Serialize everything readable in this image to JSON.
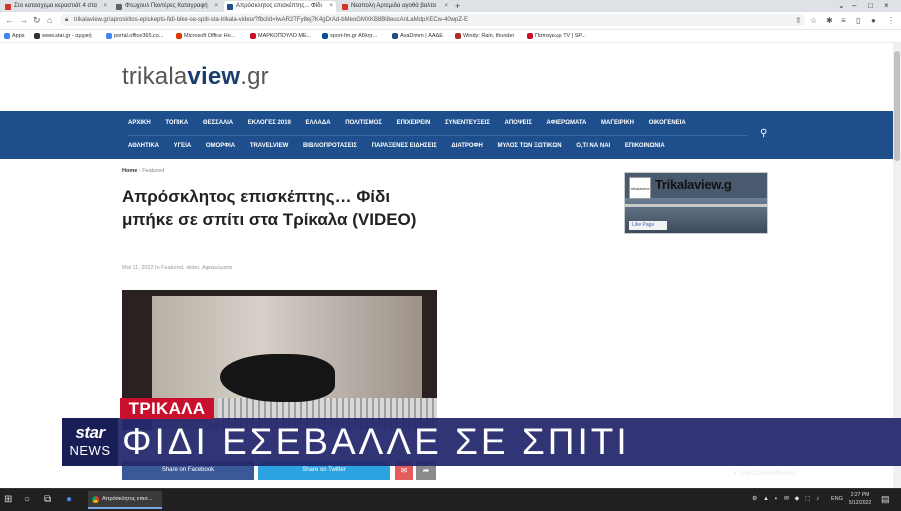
{
  "browser": {
    "tabs": [
      {
        "label": "Στο κατασχεμα κεραστιάτ 4 στα",
        "color": "#d93025"
      },
      {
        "label": "Φτωχουλ Παντέρες Καταγραφή",
        "color": "#5f6368"
      },
      {
        "label": "Απρόσκλητος επισκέπτης... Φίδι",
        "color": "#1e4f8c"
      },
      {
        "label": "Νεαπολη Αρτεμιδα αγοθά βαλτα",
        "color": "#d93025"
      }
    ],
    "new_tab": "+",
    "url": "trikalaview.gr/aproskltos-episkepts-fidi-bike-se-spiti-sta-trikala-video/?fbclid=IwAR2TFy8ej7K4gDrAd-bMeoGMXKB8Bl8eucAnLaMdpXECw-40wpZ-E",
    "lock_icon": "lock-icon",
    "bookmarks": [
      {
        "label": "Apps",
        "color": "#4285f4"
      },
      {
        "label": "www.star.gr - αρχική",
        "color": "#333333"
      },
      {
        "label": "portal.office365.co...",
        "color": "#4285f4"
      },
      {
        "label": "Microsoft Office Ho...",
        "color": "#d83b01"
      },
      {
        "label": "ΜΑΡΚΟΠΟΥΛΟ ΜΕ...",
        "color": "#c8102e"
      },
      {
        "label": "sport-fm.gr Αθλητ...",
        "color": "#0a4d9e"
      },
      {
        "label": "AvaDimm | ΑΑΔΕ",
        "color": "#1e4f8c"
      },
      {
        "label": "Windy: Rain, thunder",
        "color": "#b02a2a"
      },
      {
        "label": "Παπαγεωρ TV | SP...",
        "color": "#c8102e"
      }
    ]
  },
  "site": {
    "logo_prefix": "trikala",
    "logo_bold": "view",
    "logo_suffix": ".gr",
    "nav_row1": [
      "ΑΡΧΙΚΗ",
      "ΤΟΠΙΚΑ",
      "ΘΕΣΣΑΛΙΑ",
      "ΕΚΛΟΓΕΣ 2019",
      "ΕΛΛΑΔΑ",
      "ΠΟΛΙΤΙΣΜΟΣ",
      "ΕΠΙΧΕΙΡΕΙΝ",
      "ΣΥΝΕΝΤΕΥΞΕΙΣ",
      "ΑΠΟΨΕΙΣ",
      "ΑΦΙΕΡΩΜΑΤΑ",
      "ΜΑΓΕΙΡΙΚΗ",
      "ΟΙΚΟΓΕΝΕΙΑ"
    ],
    "nav_row2": [
      "ΑΘΛΗΤΙΚΑ",
      "ΥΓΕΙΑ",
      "ΟΜΟΡΦΙΑ",
      "TRAVELVIEW",
      "ΒΙΒΛΙΟΠΡΟΤΑΣΕΙΣ",
      "ΠΑΡΑΞΕΝΕΣ ΕΙΔΗΣΕΙΣ",
      "ΔΙΑΤΡΟΦΗ",
      "ΜΥΛΟΣ ΤΩΝ ΞΩΤΙΚΩΝ",
      "Ο,ΤΙ ΝΑ ΝΑΙ",
      "ΕΠΙΚΟΙΝΩΝΙΑ"
    ],
    "search_icon": "search-icon"
  },
  "article": {
    "breadcrumb_home": "Home",
    "breadcrumb_sep": "›",
    "breadcrumb_current": "Featured",
    "title": "Απρόσκλητος επισκέπτης… Φίδι μπήκε σε σπίτι στα Τρίκαλα (VIDEO)",
    "meta": "Μαϊ 11, 2022  In Featured, slider, Αφιερώματα",
    "share_facebook": "Share on Facebook",
    "share_twitter": "Share on Twitter",
    "share_more_icon": "share-icon",
    "mail_icon": "mail-icon"
  },
  "widget": {
    "title_prefix": "Trikala",
    "title_bold": "view.g",
    "like": "Like Page",
    "thumb": "trikalaview"
  },
  "tv": {
    "location": "ΤΡΙΚΑΛΑ",
    "headline": "ΦΙΔΙ ΕΣΕΒΑΛΛΕ ΣΕ ΣΠΙΤΙ",
    "logo_top": "star",
    "logo_bottom": "NEWS",
    "channel": "• StarChannelNews",
    "strap_color": "#c8102e",
    "bar_color": "#262a6e"
  },
  "taskbar": {
    "app_label": "Απρόσκλητος επισ...",
    "lang": "ENG",
    "time": "2:27 PM",
    "date": "5/12/2022"
  }
}
